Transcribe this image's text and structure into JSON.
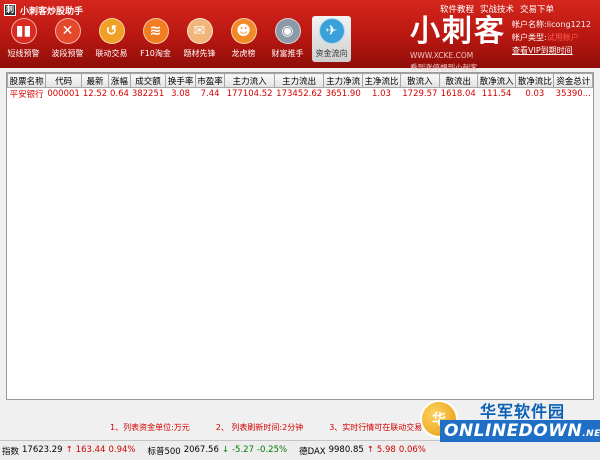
{
  "app": {
    "title": "小刺客炒股助手",
    "logo_letter": "刺"
  },
  "top_links": [
    "软件教程",
    "实战技术",
    "交易下单"
  ],
  "toolbar": [
    {
      "label": "短线预警",
      "glyph": "▮▮",
      "color": "#d92a20"
    },
    {
      "label": "波段预警",
      "glyph": "✕",
      "color": "#e5482a"
    },
    {
      "label": "联动交易",
      "glyph": "↺",
      "color": "#f0a024"
    },
    {
      "label": "F10淘金",
      "glyph": "≋",
      "color": "#f27d20"
    },
    {
      "label": "题材先锋",
      "glyph": "✉",
      "color": "#f0b67a"
    },
    {
      "label": "龙虎榜",
      "glyph": "☻",
      "color": "#f28a25"
    },
    {
      "label": "财富推手",
      "glyph": "◉",
      "color": "#8c9aa7"
    },
    {
      "label": "资金流向",
      "glyph": "✈",
      "color": "#3aa0d8"
    }
  ],
  "brand": {
    "name": "小刺客",
    "website": "WWW.XCKE.COM",
    "slogan": "看到涨停想到小刺客"
  },
  "account": {
    "name_label": "帐户名称:",
    "name_value": "licong1212",
    "type_label": "帐户类型:",
    "type_value": "试用帐户",
    "vip_label": "查看VIP到期时间"
  },
  "table": {
    "headers": [
      "股票名称",
      "代码",
      "最新",
      "涨幅",
      "成交额",
      "换手率",
      "市盈率",
      "主力流入",
      "主力流出",
      "主力净流",
      "主净流比",
      "散流入",
      "散流出",
      "散净流入",
      "散净流比",
      "资金总计"
    ],
    "rows": [
      [
        "平安银行",
        "000001",
        "12.52",
        "0.64",
        "382251",
        "3.08",
        "7.44",
        "177104.52",
        "173452.62",
        "3651.90",
        "1.03",
        "1729.57",
        "1618.04",
        "111.54",
        "0.03",
        "35390..."
      ]
    ]
  },
  "notes": [
    "1、列表资金单位:万元",
    "2、 列表刷新时间:2分钟",
    "3、实时行情可在联动交易中打开"
  ],
  "statusbar": [
    {
      "name": "指数",
      "value": "17623.29",
      "arrow": "↑",
      "change": "163.44",
      "pct": "0.94%",
      "dir": "up"
    },
    {
      "name": "标普500",
      "value": "2067.56",
      "arrow": "↓",
      "change": "-5.27",
      "pct": "-0.25%",
      "dir": "down"
    },
    {
      "name": "德DAX",
      "value": "9980.85",
      "arrow": "↑",
      "change": "5.98",
      "pct": "0.06%",
      "dir": "up"
    }
  ],
  "watermark": {
    "cn": "华军软件园",
    "en": "ONLINEDOWN",
    "suffix": ".NET",
    "mark": "华"
  }
}
